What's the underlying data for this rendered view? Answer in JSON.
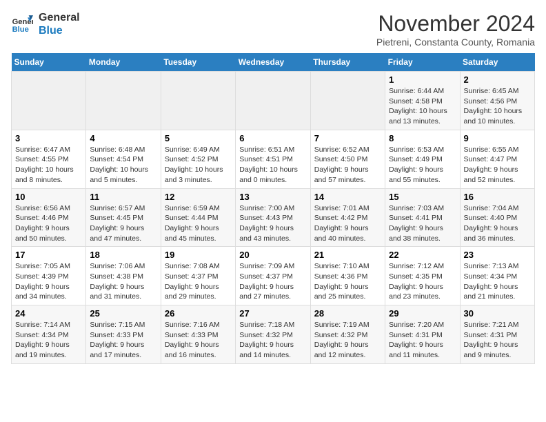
{
  "logo": {
    "text_general": "General",
    "text_blue": "Blue"
  },
  "title": "November 2024",
  "location": "Pietreni, Constanta County, Romania",
  "weekdays": [
    "Sunday",
    "Monday",
    "Tuesday",
    "Wednesday",
    "Thursday",
    "Friday",
    "Saturday"
  ],
  "weeks": [
    [
      {
        "day": "",
        "info": ""
      },
      {
        "day": "",
        "info": ""
      },
      {
        "day": "",
        "info": ""
      },
      {
        "day": "",
        "info": ""
      },
      {
        "day": "",
        "info": ""
      },
      {
        "day": "1",
        "info": "Sunrise: 6:44 AM\nSunset: 4:58 PM\nDaylight: 10 hours and 13 minutes."
      },
      {
        "day": "2",
        "info": "Sunrise: 6:45 AM\nSunset: 4:56 PM\nDaylight: 10 hours and 10 minutes."
      }
    ],
    [
      {
        "day": "3",
        "info": "Sunrise: 6:47 AM\nSunset: 4:55 PM\nDaylight: 10 hours and 8 minutes."
      },
      {
        "day": "4",
        "info": "Sunrise: 6:48 AM\nSunset: 4:54 PM\nDaylight: 10 hours and 5 minutes."
      },
      {
        "day": "5",
        "info": "Sunrise: 6:49 AM\nSunset: 4:52 PM\nDaylight: 10 hours and 3 minutes."
      },
      {
        "day": "6",
        "info": "Sunrise: 6:51 AM\nSunset: 4:51 PM\nDaylight: 10 hours and 0 minutes."
      },
      {
        "day": "7",
        "info": "Sunrise: 6:52 AM\nSunset: 4:50 PM\nDaylight: 9 hours and 57 minutes."
      },
      {
        "day": "8",
        "info": "Sunrise: 6:53 AM\nSunset: 4:49 PM\nDaylight: 9 hours and 55 minutes."
      },
      {
        "day": "9",
        "info": "Sunrise: 6:55 AM\nSunset: 4:47 PM\nDaylight: 9 hours and 52 minutes."
      }
    ],
    [
      {
        "day": "10",
        "info": "Sunrise: 6:56 AM\nSunset: 4:46 PM\nDaylight: 9 hours and 50 minutes."
      },
      {
        "day": "11",
        "info": "Sunrise: 6:57 AM\nSunset: 4:45 PM\nDaylight: 9 hours and 47 minutes."
      },
      {
        "day": "12",
        "info": "Sunrise: 6:59 AM\nSunset: 4:44 PM\nDaylight: 9 hours and 45 minutes."
      },
      {
        "day": "13",
        "info": "Sunrise: 7:00 AM\nSunset: 4:43 PM\nDaylight: 9 hours and 43 minutes."
      },
      {
        "day": "14",
        "info": "Sunrise: 7:01 AM\nSunset: 4:42 PM\nDaylight: 9 hours and 40 minutes."
      },
      {
        "day": "15",
        "info": "Sunrise: 7:03 AM\nSunset: 4:41 PM\nDaylight: 9 hours and 38 minutes."
      },
      {
        "day": "16",
        "info": "Sunrise: 7:04 AM\nSunset: 4:40 PM\nDaylight: 9 hours and 36 minutes."
      }
    ],
    [
      {
        "day": "17",
        "info": "Sunrise: 7:05 AM\nSunset: 4:39 PM\nDaylight: 9 hours and 34 minutes."
      },
      {
        "day": "18",
        "info": "Sunrise: 7:06 AM\nSunset: 4:38 PM\nDaylight: 9 hours and 31 minutes."
      },
      {
        "day": "19",
        "info": "Sunrise: 7:08 AM\nSunset: 4:37 PM\nDaylight: 9 hours and 29 minutes."
      },
      {
        "day": "20",
        "info": "Sunrise: 7:09 AM\nSunset: 4:37 PM\nDaylight: 9 hours and 27 minutes."
      },
      {
        "day": "21",
        "info": "Sunrise: 7:10 AM\nSunset: 4:36 PM\nDaylight: 9 hours and 25 minutes."
      },
      {
        "day": "22",
        "info": "Sunrise: 7:12 AM\nSunset: 4:35 PM\nDaylight: 9 hours and 23 minutes."
      },
      {
        "day": "23",
        "info": "Sunrise: 7:13 AM\nSunset: 4:34 PM\nDaylight: 9 hours and 21 minutes."
      }
    ],
    [
      {
        "day": "24",
        "info": "Sunrise: 7:14 AM\nSunset: 4:34 PM\nDaylight: 9 hours and 19 minutes."
      },
      {
        "day": "25",
        "info": "Sunrise: 7:15 AM\nSunset: 4:33 PM\nDaylight: 9 hours and 17 minutes."
      },
      {
        "day": "26",
        "info": "Sunrise: 7:16 AM\nSunset: 4:33 PM\nDaylight: 9 hours and 16 minutes."
      },
      {
        "day": "27",
        "info": "Sunrise: 7:18 AM\nSunset: 4:32 PM\nDaylight: 9 hours and 14 minutes."
      },
      {
        "day": "28",
        "info": "Sunrise: 7:19 AM\nSunset: 4:32 PM\nDaylight: 9 hours and 12 minutes."
      },
      {
        "day": "29",
        "info": "Sunrise: 7:20 AM\nSunset: 4:31 PM\nDaylight: 9 hours and 11 minutes."
      },
      {
        "day": "30",
        "info": "Sunrise: 7:21 AM\nSunset: 4:31 PM\nDaylight: 9 hours and 9 minutes."
      }
    ]
  ]
}
